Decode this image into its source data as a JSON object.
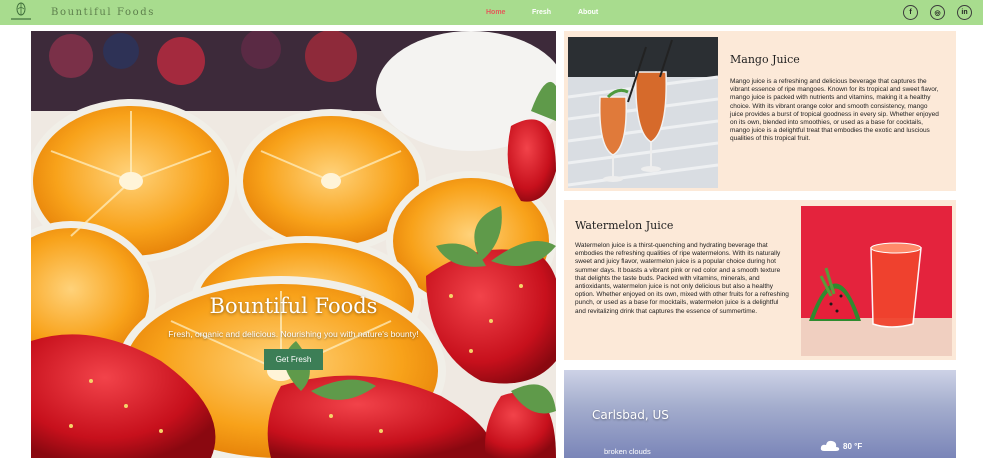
{
  "nav": {
    "logo_icon": "leaf-logo-icon",
    "brand": "Bountiful Foods",
    "links": [
      {
        "label": "Home",
        "active": true
      },
      {
        "label": "Fresh",
        "active": false
      },
      {
        "label": "About",
        "active": false
      }
    ],
    "social": [
      {
        "icon": "facebook-icon",
        "glyph": "f"
      },
      {
        "icon": "instagram-icon",
        "glyph": "◎"
      },
      {
        "icon": "linkedin-icon",
        "glyph": "in"
      }
    ],
    "colors": {
      "bar": "#a8dc8e",
      "active_link": "#e45a5a"
    }
  },
  "hero": {
    "image": "oranges-and-strawberries-photo",
    "title": "Bountiful Foods",
    "subtitle": "Fresh, organic and delicious. Nourishing you with nature's bounty!",
    "button_label": "Get Fresh",
    "button_color": "#3c7e56"
  },
  "cards": {
    "mango": {
      "image": "mango-juice-glasses-photo",
      "title": "Mango Juice",
      "text": "Mango juice is a refreshing and delicious beverage that captures the vibrant essence of ripe mangoes. Known for its tropical and sweet flavor, mango juice is packed with nutrients and vitamins, making it a healthy choice. With its vibrant orange color and smooth consistency, mango juice provides a burst of tropical goodness in every sip. Whether enjoyed on its own, blended into smoothies, or used as a base for cocktails, mango juice is a delightful treat that embodies the exotic and luscious qualities of this tropical fruit."
    },
    "watermelon": {
      "image": "watermelon-juice-glass-photo",
      "title": "Watermelon Juice",
      "text": "Watermelon juice is a thirst-quenching and hydrating beverage that embodies the refreshing qualities of ripe watermelons. With its naturally sweet and juicy flavor, watermelon juice is a popular choice during hot summer days. It boasts a vibrant pink or red color and a smooth texture that delights the taste buds. Packed with vitamins, minerals, and antioxidants, watermelon juice is not only delicious but also a healthy option. Whether enjoyed on its own, mixed with other fruits for a refreshing punch, or used as a base for mocktails, watermelon juice is a delightful and revitalizing drink that captures the essence of summertime."
    },
    "background": "#fce9d8"
  },
  "weather": {
    "city": "Carlsbad, US",
    "description": "broken clouds",
    "temperature": "80 °F",
    "icon": "cloud-icon"
  }
}
